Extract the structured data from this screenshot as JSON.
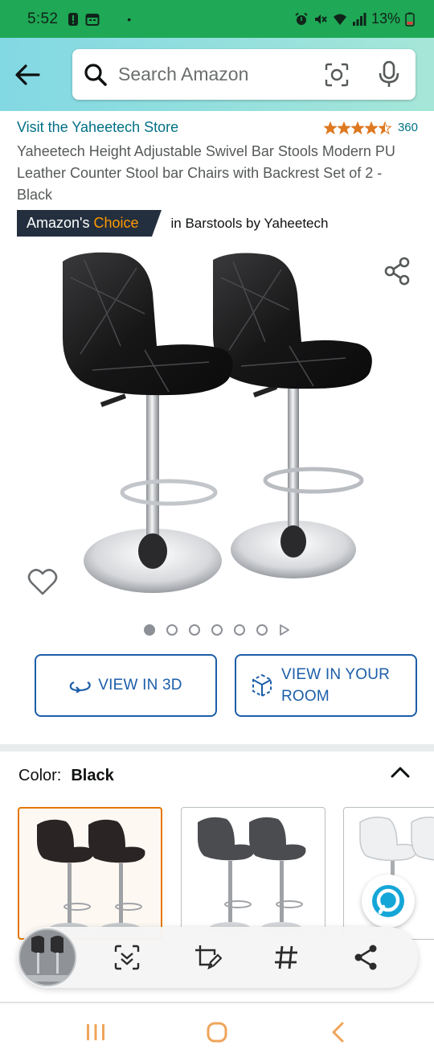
{
  "status": {
    "time": "5:52",
    "dot": "•",
    "battery": "13%"
  },
  "search": {
    "placeholder": "Search Amazon"
  },
  "product": {
    "store_link": "Visit the Yaheetech Store",
    "rating": 4.5,
    "rating_count": "360",
    "title": "Yaheetech Height Adjustable Swivel Bar Stools Modern PU Leather Counter Stool bar Chairs with Backrest Set of 2 - Black",
    "badge_prefix": "Amazon's",
    "badge_highlight": "Choice",
    "badge_category": "in Barstools by Yaheetech"
  },
  "gallery": {
    "image_count": 6,
    "active_index": 0,
    "has_video": true
  },
  "buttons": {
    "view_3d": "VIEW IN 3D",
    "view_room": "VIEW IN YOUR ROOM"
  },
  "color": {
    "label": "Color:",
    "value": "Black",
    "options": [
      {
        "name": "Black",
        "selected": true
      },
      {
        "name": "Grey",
        "selected": false
      },
      {
        "name": "White",
        "selected": false
      }
    ]
  },
  "colors": {
    "link": "#007185",
    "accent": "#ff9900",
    "badge_bg": "#232f3e",
    "button_blue": "#1c5ea8",
    "status_bar": "#1fa855",
    "swatch_selected": "#e77600"
  },
  "icons": {
    "back": "arrow-left-icon",
    "search": "search-icon",
    "camera": "camera-lens-icon",
    "mic": "microphone-icon",
    "share": "share-icon",
    "wishlist": "heart-icon",
    "alexa": "alexa-icon",
    "toolbar": [
      "scan-icon",
      "edit-crop-icon",
      "hashtag-icon",
      "share-icon"
    ],
    "nav": [
      "recent-apps-icon",
      "home-icon",
      "back-icon"
    ]
  }
}
